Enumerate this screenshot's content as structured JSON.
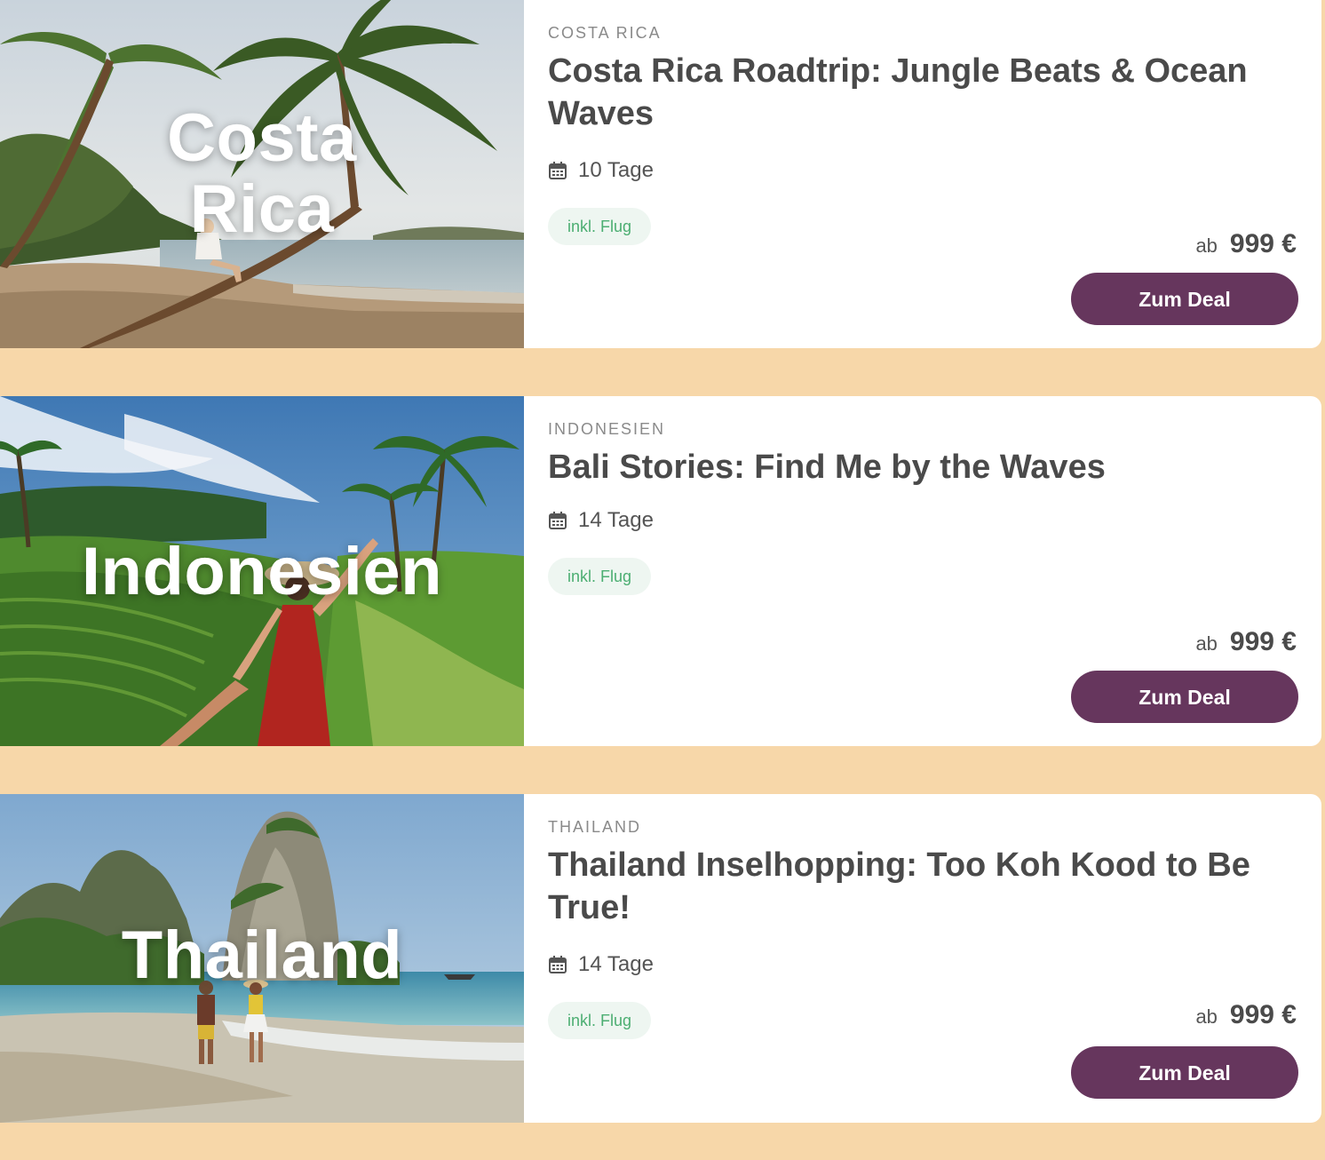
{
  "offers": [
    {
      "image_label": "Costa Rica",
      "country": "COSTA RICA",
      "title": "Costa Rica Roadtrip: Jungle Beats & Ocean Waves",
      "duration": "10 Tage",
      "badge": "inkl. Flug",
      "price_prefix": "ab",
      "price": "999 €",
      "cta_label": "Zum Deal"
    },
    {
      "image_label": "Indonesien",
      "country": "INDONESIEN",
      "title": "Bali Stories: Find Me by the Waves",
      "duration": "14 Tage",
      "badge": "inkl. Flug",
      "price_prefix": "ab",
      "price": "999 €",
      "cta_label": "Zum Deal"
    },
    {
      "image_label": "Thailand",
      "country": "THAILAND",
      "title": "Thailand Inselhopping: Too Koh Kood to Be True!",
      "duration": "14 Tage",
      "badge": "inkl. Flug",
      "price_prefix": "ab",
      "price": "999 €",
      "cta_label": "Zum Deal"
    }
  ],
  "colors": {
    "page_background": "#f7d7a9",
    "card_background": "#ffffff",
    "cta_background": "#66365d",
    "badge_background": "#eef6f1",
    "badge_text": "#4cae72",
    "title_text": "#4a4a4a"
  },
  "icons": {
    "duration": "calendar-icon"
  }
}
